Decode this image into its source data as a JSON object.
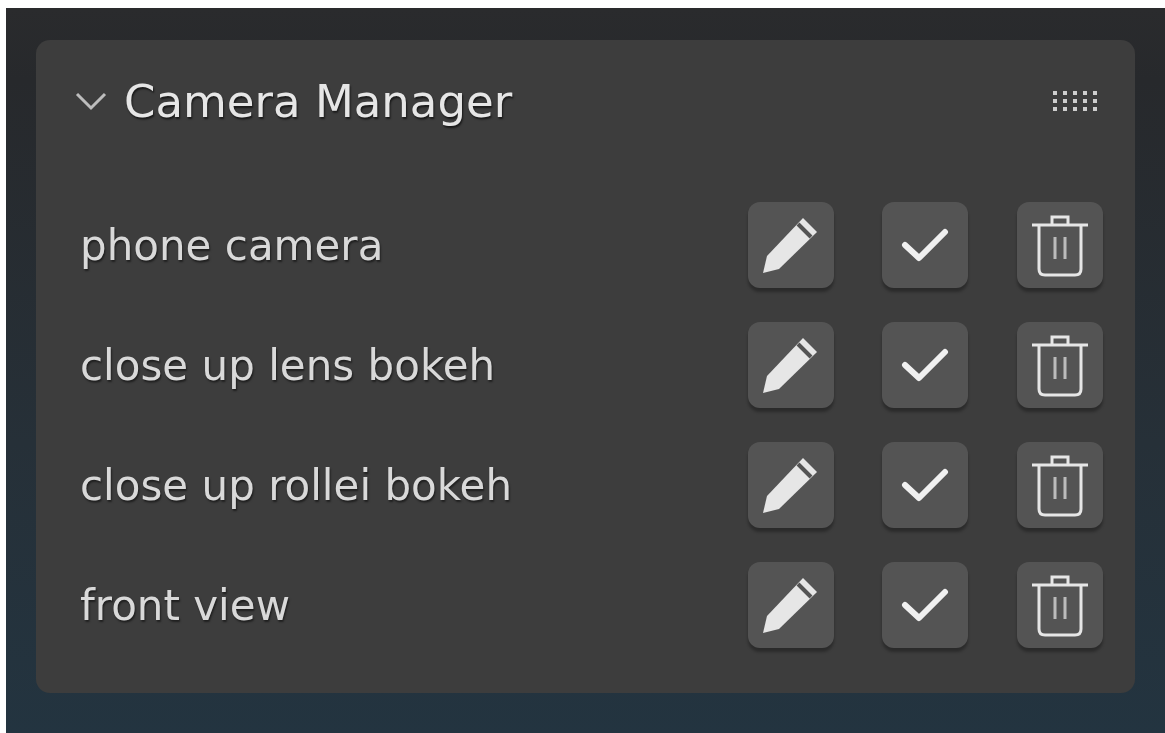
{
  "panel": {
    "title": "Camera Manager",
    "expanded": true
  },
  "cameras": [
    {
      "name": "phone camera"
    },
    {
      "name": "close up lens bokeh"
    },
    {
      "name": "close up rollei bokeh"
    },
    {
      "name": "front view"
    }
  ]
}
